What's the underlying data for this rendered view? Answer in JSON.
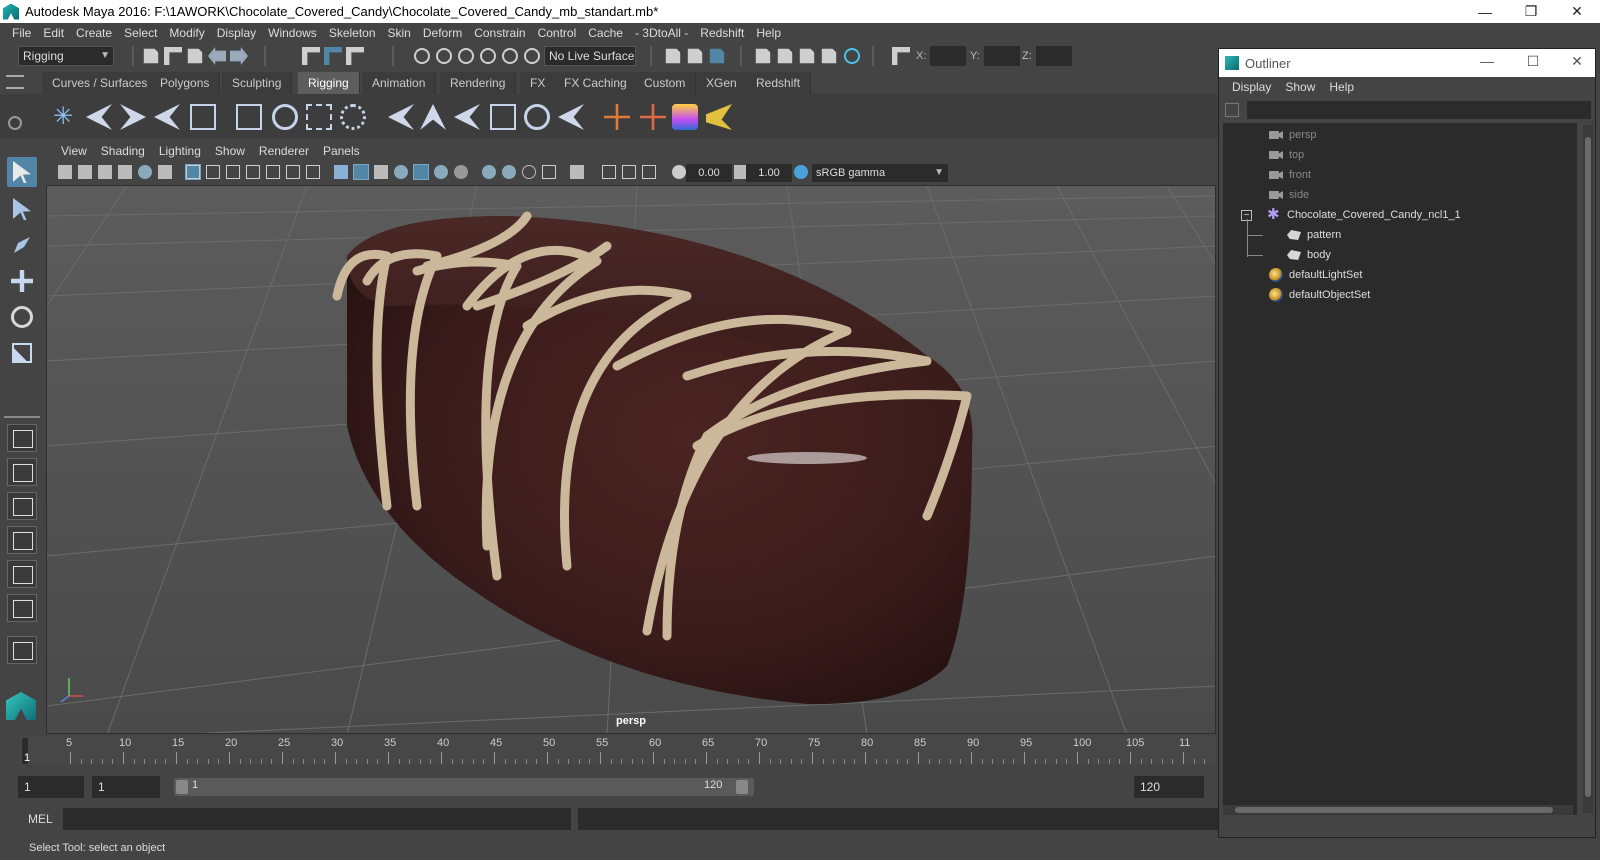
{
  "window": {
    "title": "Autodesk Maya 2016: F:\\1AWORK\\Chocolate_Covered_Candy\\Chocolate_Covered_Candy_mb_standart.mb*",
    "minimize": "—",
    "restore": "❐",
    "close": "✕"
  },
  "menubar": [
    "File",
    "Edit",
    "Create",
    "Select",
    "Modify",
    "Display",
    "Windows",
    "Skeleton",
    "Skin",
    "Deform",
    "Constrain",
    "Control",
    "Cache",
    "- 3DtoAll -",
    "Redshift",
    "Help"
  ],
  "statusline": {
    "mode": "Rigging",
    "live_surface": "No Live Surface",
    "x_label": "X:",
    "y_label": "Y:",
    "z_label": "Z:"
  },
  "shelf_tabs": [
    "Curves / Surfaces",
    "Polygons",
    "Sculpting",
    "Rigging",
    "Animation",
    "Rendering",
    "FX",
    "FX Caching",
    "Custom",
    "XGen",
    "Redshift"
  ],
  "shelf_active_tab": "Rigging",
  "panel_menu": [
    "View",
    "Shading",
    "Lighting",
    "Show",
    "Renderer",
    "Panels"
  ],
  "panel_tools": {
    "exposure": "0.00",
    "gamma": "1.00",
    "color_space": "sRGB gamma"
  },
  "viewport": {
    "camera": "persp",
    "colors": {
      "chocolate": "#3a1d1c",
      "drizzle": "#cbb89a",
      "grid": "#7a7a7a"
    }
  },
  "timeline": {
    "ticks": [
      "5",
      "10",
      "15",
      "20",
      "25",
      "30",
      "35",
      "40",
      "45",
      "50",
      "55",
      "60",
      "65",
      "70",
      "75",
      "80",
      "85",
      "90",
      "95",
      "100",
      "105",
      "11"
    ],
    "current_frame": "1"
  },
  "range": {
    "start": "1",
    "anim_start": "1",
    "range_start": "1",
    "range_end": "120",
    "anim_end": "120"
  },
  "cmdline": {
    "mel_label": "MEL"
  },
  "helpline": "Select Tool: select an object",
  "outliner": {
    "title": "Outliner",
    "menu": [
      "Display",
      "Show",
      "Help"
    ],
    "items": [
      {
        "label": "persp",
        "icon": "camera-icon"
      },
      {
        "label": "top",
        "icon": "camera-icon"
      },
      {
        "label": "front",
        "icon": "camera-icon"
      },
      {
        "label": "side",
        "icon": "camera-icon"
      },
      {
        "label": "Chocolate_Covered_Candy_ncl1_1",
        "icon": "group-icon"
      },
      {
        "label": "pattern",
        "icon": "mesh-icon"
      },
      {
        "label": "body",
        "icon": "mesh-icon"
      },
      {
        "label": "defaultLightSet",
        "icon": "set-icon"
      },
      {
        "label": "defaultObjectSet",
        "icon": "set-icon"
      }
    ],
    "expander": "−"
  }
}
